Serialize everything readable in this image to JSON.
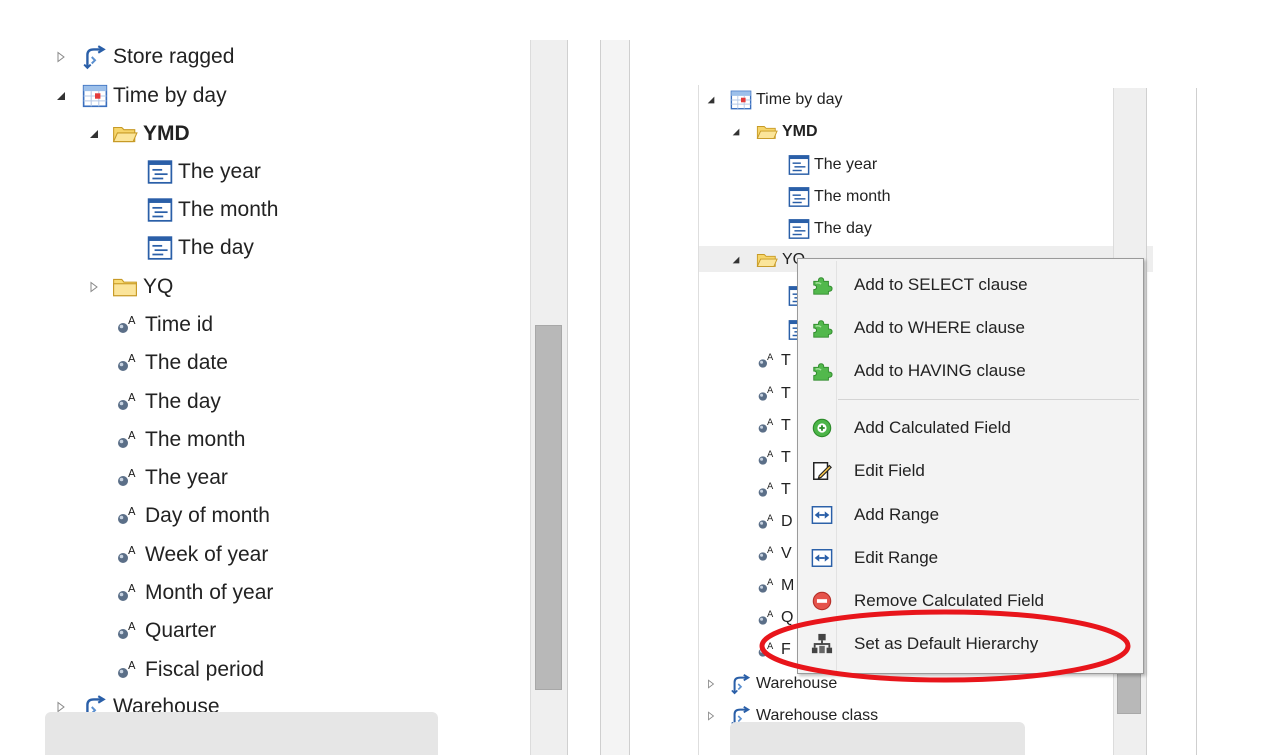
{
  "left_tree": {
    "items": [
      {
        "label": "Store ragged",
        "icon": "hierarchy-icon",
        "expander": "collapsed"
      },
      {
        "label": "Time by day",
        "icon": "calendar-table-icon",
        "expander": "expanded"
      },
      {
        "label": "YMD",
        "icon": "folder-open-icon",
        "expander": "expanded",
        "bold": true
      },
      {
        "label": "The year",
        "icon": "level-icon"
      },
      {
        "label": "The month",
        "icon": "level-icon"
      },
      {
        "label": "The day",
        "icon": "level-icon"
      },
      {
        "label": "YQ",
        "icon": "folder-icon",
        "expander": "collapsed"
      },
      {
        "label": "Time id",
        "icon": "attribute-icon"
      },
      {
        "label": "The date",
        "icon": "attribute-icon"
      },
      {
        "label": "The day",
        "icon": "attribute-icon"
      },
      {
        "label": "The month",
        "icon": "attribute-icon"
      },
      {
        "label": "The year",
        "icon": "attribute-icon"
      },
      {
        "label": "Day of month",
        "icon": "attribute-icon"
      },
      {
        "label": "Week of year",
        "icon": "attribute-icon"
      },
      {
        "label": "Month of year",
        "icon": "attribute-icon"
      },
      {
        "label": "Quarter",
        "icon": "attribute-icon"
      },
      {
        "label": "Fiscal period",
        "icon": "attribute-icon"
      },
      {
        "label": "Warehouse",
        "icon": "hierarchy-icon",
        "expander": "collapsed"
      }
    ]
  },
  "right_tree": {
    "items": [
      {
        "label": "Time by day",
        "icon": "calendar-table-icon",
        "expander": "expanded"
      },
      {
        "label": "YMD",
        "icon": "folder-open-icon",
        "expander": "expanded",
        "bold": true
      },
      {
        "label": "The year",
        "icon": "level-icon"
      },
      {
        "label": "The month",
        "icon": "level-icon"
      },
      {
        "label": "The day",
        "icon": "level-icon"
      },
      {
        "label": "YQ",
        "icon": "folder-open-icon",
        "expander": "expanded"
      },
      {
        "label": "",
        "icon": "level-icon"
      },
      {
        "label": "",
        "icon": "level-icon"
      },
      {
        "label": "T",
        "icon": "attribute-icon"
      },
      {
        "label": "T",
        "icon": "attribute-icon"
      },
      {
        "label": "T",
        "icon": "attribute-icon"
      },
      {
        "label": "T",
        "icon": "attribute-icon"
      },
      {
        "label": "T",
        "icon": "attribute-icon"
      },
      {
        "label": "D",
        "icon": "attribute-icon"
      },
      {
        "label": "V",
        "icon": "attribute-icon"
      },
      {
        "label": "M",
        "icon": "attribute-icon"
      },
      {
        "label": "Q",
        "icon": "attribute-icon"
      },
      {
        "label": "F",
        "icon": "attribute-icon"
      },
      {
        "label": "Warehouse",
        "icon": "hierarchy-icon",
        "expander": "collapsed"
      },
      {
        "label": "Warehouse class",
        "icon": "hierarchy-icon",
        "expander": "collapsed"
      }
    ]
  },
  "context_menu": {
    "items": [
      {
        "label": "Add to SELECT clause",
        "icon": "puzzle-icon"
      },
      {
        "label": "Add to WHERE clause",
        "icon": "puzzle-icon"
      },
      {
        "label": "Add to HAVING clause",
        "icon": "puzzle-icon"
      },
      {
        "label": "Add Calculated Field",
        "icon": "plus-circle-icon"
      },
      {
        "label": "Edit Field",
        "icon": "edit-icon"
      },
      {
        "label": "Add Range",
        "icon": "range-icon"
      },
      {
        "label": "Edit Range",
        "icon": "range-icon"
      },
      {
        "label": "Remove Calculated Field",
        "icon": "minus-circle-icon"
      },
      {
        "label": "Set as Default Hierarchy",
        "icon": "hierarchy-tree-icon"
      }
    ]
  },
  "colors": {
    "highlight_ellipse": "#e8151b",
    "scrollbar_thumb": "#b8b8b8",
    "scrollbar_track": "#efefef",
    "folder_yellow": "#f6d56a",
    "level_icon_blue": "#2a5fa8"
  }
}
